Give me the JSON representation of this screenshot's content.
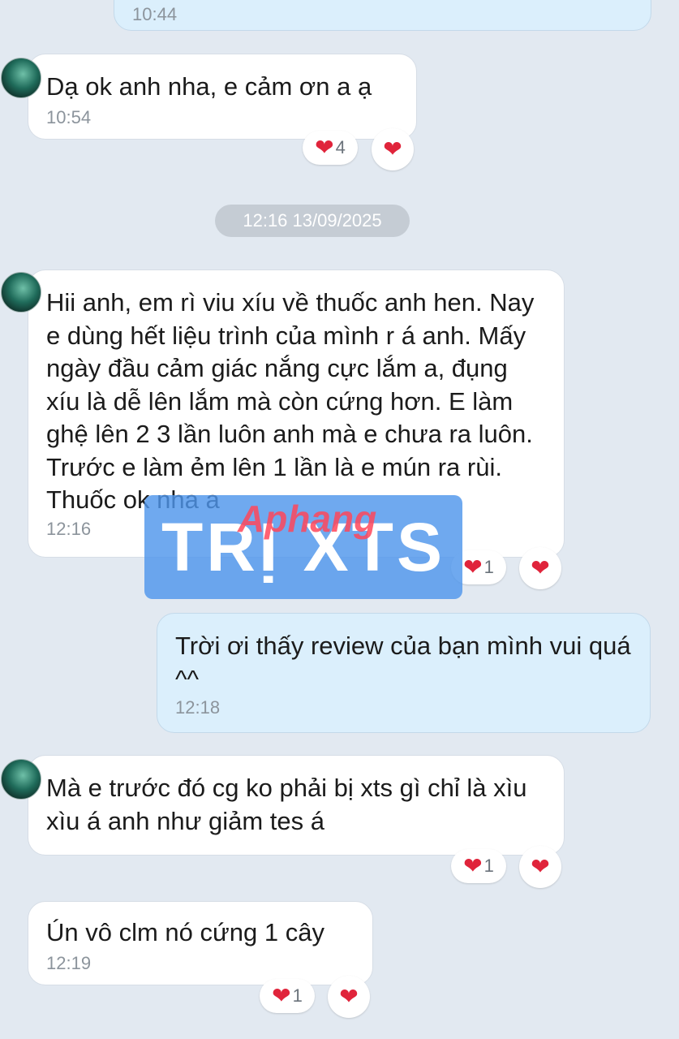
{
  "messages": [
    {
      "text": "",
      "time": "10:44"
    },
    {
      "text": "Dạ ok anh nha, e cảm ơn a ạ",
      "time": "10:54",
      "reaction_count": "4"
    },
    {
      "text": "Hii anh, em rì viu xíu về thuốc anh hen. Nay e dùng hết liệu trình của mình r á anh. Mấy ngày đầu cảm giác nắng cực lắm a, đụng xíu là dễ lên lắm mà còn cứng hơn. E làm ghệ lên 2 3 lần luôn anh mà e chưa ra luôn. Trước e làm ẻm lên 1 lần là e mún ra rùi. Thuốc ok nha a",
      "time": "12:16",
      "reaction_count": "1"
    },
    {
      "text": "Trời ơi thấy review của bạn mình vui quá ^^",
      "time": "12:18"
    },
    {
      "text": "Mà e trước đó cg ko phải bị xts gì chỉ là xìu xìu á anh như giảm tes á",
      "time": "12:19_",
      "reaction_count": "1"
    },
    {
      "text": "Ún vô clm nó cứng 1 cây",
      "time": "12:19",
      "reaction_count": "1"
    }
  ],
  "date_separator": "12:16 13/09/2025",
  "watermark": {
    "text": "TRỊ XTS",
    "overlay": "Aphang"
  },
  "icons": {
    "reaction": "heart-icon",
    "avatar": "avatar"
  },
  "colors": {
    "background": "#e2e9f1",
    "incoming": "#ffffff",
    "outgoing": "#dbeffc",
    "heart": "#e0243b"
  }
}
